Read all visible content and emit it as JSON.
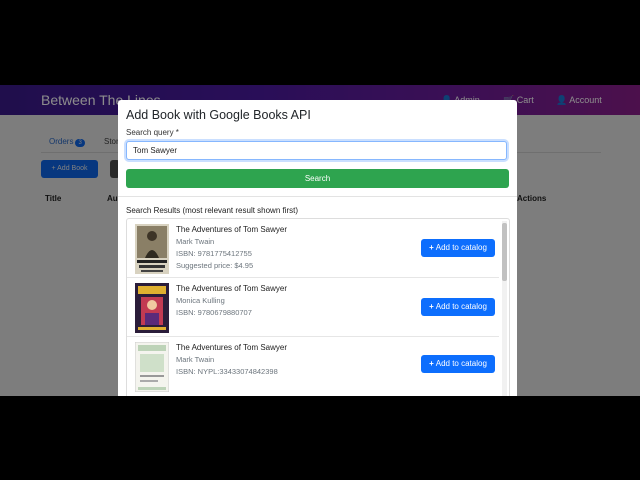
{
  "navbar": {
    "brand": "Between The Lines",
    "admin": "Admin",
    "cart": "Cart",
    "account": "Account"
  },
  "background": {
    "tab_orders": "Orders",
    "orders_badge": "3",
    "tab_store": "Store",
    "add_book_label": "Add Book",
    "col_title": "Title",
    "col_author": "Au",
    "col_actions": "Actions"
  },
  "modal": {
    "title": "Add Book with Google Books API",
    "query_label": "Search query *",
    "query_value": "Tom Sawyer",
    "search_button": "Search",
    "results_label": "Search Results (most relevant result shown first)",
    "add_button_label": "Add to catalog",
    "results": [
      {
        "title": "The Adventures of Tom Sawyer",
        "author": "Mark Twain",
        "isbn": "ISBN: 9781775412755",
        "price": "Suggested price: $4.95",
        "cover": "cover-icon-1"
      },
      {
        "title": "The Adventures of Tom Sawyer",
        "author": "Monica Kulling",
        "isbn": "ISBN: 9780679880707",
        "price": "",
        "cover": "cover-icon-2"
      },
      {
        "title": "The Adventures of Tom Sawyer",
        "author": "Mark Twain",
        "isbn": "ISBN: NYPL:33433074842398",
        "price": "",
        "cover": "cover-icon-3"
      }
    ]
  }
}
